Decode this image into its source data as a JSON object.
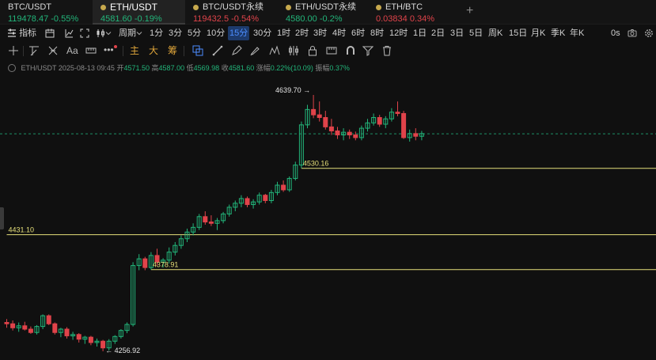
{
  "tabs": [
    {
      "symbol": "BTC/USDT",
      "price": "119478.47",
      "change": "-0.55%",
      "price_dir": "up",
      "change_dir": "up",
      "active": false
    },
    {
      "symbol": "ETH/USDT",
      "price": "4581.60",
      "change": "-0.19%",
      "price_dir": "up",
      "change_dir": "up",
      "active": true
    },
    {
      "symbol": "BTC/USDT永续",
      "price": "119432.5",
      "change": "-0.54%",
      "price_dir": "down",
      "change_dir": "down",
      "active": false
    },
    {
      "symbol": "ETH/USDT永续",
      "price": "4580.00",
      "change": "-0.2%",
      "price_dir": "up",
      "change_dir": "up",
      "active": false
    },
    {
      "symbol": "ETH/BTC",
      "price": "0.03834",
      "change": "0.34%",
      "price_dir": "down",
      "change_dir": "down",
      "active": false
    }
  ],
  "add_tab": "+",
  "toolbar": {
    "indicator": "指标",
    "period": "期",
    "period_label": "周期",
    "intervals": [
      "1分",
      "3分",
      "5分",
      "10分",
      "15分",
      "30分",
      "1时",
      "2时",
      "3时",
      "4时",
      "6时",
      "8时",
      "12时",
      "1日",
      "2日",
      "3日",
      "5日",
      "周K",
      "15日",
      "月K",
      "季K",
      "年K"
    ],
    "selected_interval": "15分",
    "countdown": "0s"
  },
  "drawbar": {
    "main": "主",
    "big": "大",
    "chip": "筹"
  },
  "ohlc": {
    "symbol": "ETH/USDT",
    "time": "2025-08-13 09:45",
    "open_label": "开",
    "open": "4571.50",
    "high_label": "高",
    "high": "4587.00",
    "low_label": "低",
    "low": "4569.98",
    "close_label": "收",
    "close": "4581.60",
    "change_label": "涨幅",
    "change": "0.22%(10.09)",
    "amp_label": "振幅",
    "amp": "0.37%"
  },
  "colors": {
    "up": "#22b57a",
    "down": "#e0434a",
    "bg": "#101010",
    "level": "#e6e07a",
    "accent": "#4c8dff"
  },
  "chart_data": {
    "type": "candlestick",
    "interval": "15分",
    "high_label": "4639.70",
    "low_label": "4256.92",
    "current_price": 4581.6,
    "levels": [
      {
        "price": 4530.16,
        "label": "4530.16"
      },
      {
        "price": 4431.1,
        "label": "4431.10"
      },
      {
        "price": 4378.91,
        "label": "4378.91"
      }
    ],
    "candles": [
      [
        4300,
        4305,
        4292,
        4298
      ],
      [
        4298,
        4303,
        4288,
        4292
      ],
      [
        4292,
        4300,
        4286,
        4295
      ],
      [
        4295,
        4301,
        4288,
        4290
      ],
      [
        4290,
        4294,
        4283,
        4285
      ],
      [
        4285,
        4296,
        4282,
        4294
      ],
      [
        4294,
        4312,
        4290,
        4310
      ],
      [
        4310,
        4312,
        4296,
        4298
      ],
      [
        4298,
        4300,
        4282,
        4285
      ],
      [
        4285,
        4292,
        4278,
        4290
      ],
      [
        4290,
        4293,
        4276,
        4280
      ],
      [
        4280,
        4286,
        4274,
        4282
      ],
      [
        4282,
        4284,
        4270,
        4275
      ],
      [
        4275,
        4280,
        4268,
        4278
      ],
      [
        4278,
        4280,
        4266,
        4270
      ],
      [
        4270,
        4276,
        4264,
        4272
      ],
      [
        4272,
        4274,
        4256.92,
        4262
      ],
      [
        4262,
        4275,
        4258,
        4272
      ],
      [
        4272,
        4281,
        4268,
        4279
      ],
      [
        4279,
        4290,
        4276,
        4288
      ],
      [
        4288,
        4300,
        4284,
        4297
      ],
      [
        4297,
        4390,
        4294,
        4385
      ],
      [
        4385,
        4402,
        4378,
        4395
      ],
      [
        4395,
        4398,
        4378,
        4382
      ],
      [
        4382,
        4405,
        4378.91,
        4400
      ],
      [
        4400,
        4410,
        4385,
        4390
      ],
      [
        4390,
        4396,
        4382,
        4393
      ],
      [
        4393,
        4412,
        4388,
        4405
      ],
      [
        4405,
        4420,
        4400,
        4415
      ],
      [
        4415,
        4430,
        4410,
        4425
      ],
      [
        4425,
        4440,
        4420,
        4435
      ],
      [
        4435,
        4448,
        4430,
        4442
      ],
      [
        4442,
        4462,
        4438,
        4458
      ],
      [
        4458,
        4466,
        4446,
        4450
      ],
      [
        4450,
        4460,
        4444,
        4448
      ],
      [
        4448,
        4456,
        4438,
        4452
      ],
      [
        4452,
        4465,
        4448,
        4462
      ],
      [
        4462,
        4476,
        4458,
        4472
      ],
      [
        4472,
        4482,
        4466,
        4478
      ],
      [
        4478,
        4490,
        4472,
        4485
      ],
      [
        4485,
        4488,
        4472,
        4476
      ],
      [
        4476,
        4484,
        4470,
        4480
      ],
      [
        4480,
        4494,
        4476,
        4490
      ],
      [
        4490,
        4492,
        4478,
        4482
      ],
      [
        4482,
        4498,
        4478,
        4494
      ],
      [
        4494,
        4510,
        4490,
        4505
      ],
      [
        4505,
        4512,
        4495,
        4498
      ],
      [
        4498,
        4518,
        4495,
        4515
      ],
      [
        4515,
        4540,
        4512,
        4535
      ],
      [
        4535,
        4600,
        4530.16,
        4595
      ],
      [
        4595,
        4625,
        4590,
        4618
      ],
      [
        4618,
        4639.7,
        4605,
        4610
      ],
      [
        4610,
        4630,
        4600,
        4606
      ],
      [
        4606,
        4616,
        4588,
        4592
      ],
      [
        4592,
        4604,
        4580,
        4586
      ],
      [
        4586,
        4592,
        4574,
        4580
      ],
      [
        4580,
        4590,
        4572,
        4584
      ],
      [
        4584,
        4588,
        4574,
        4580
      ],
      [
        4580,
        4585,
        4572,
        4576
      ],
      [
        4576,
        4594,
        4572,
        4590
      ],
      [
        4590,
        4604,
        4585,
        4598
      ],
      [
        4598,
        4612,
        4594,
        4606
      ],
      [
        4606,
        4610,
        4592,
        4596
      ],
      [
        4596,
        4608,
        4590,
        4604
      ],
      [
        4604,
        4620,
        4600,
        4614
      ],
      [
        4614,
        4630,
        4608,
        4612
      ],
      [
        4612,
        4616,
        4574,
        4576
      ],
      [
        4576,
        4588,
        4570,
        4582
      ],
      [
        4582,
        4590,
        4572,
        4578
      ],
      [
        4578,
        4586,
        4572,
        4582
      ]
    ]
  }
}
